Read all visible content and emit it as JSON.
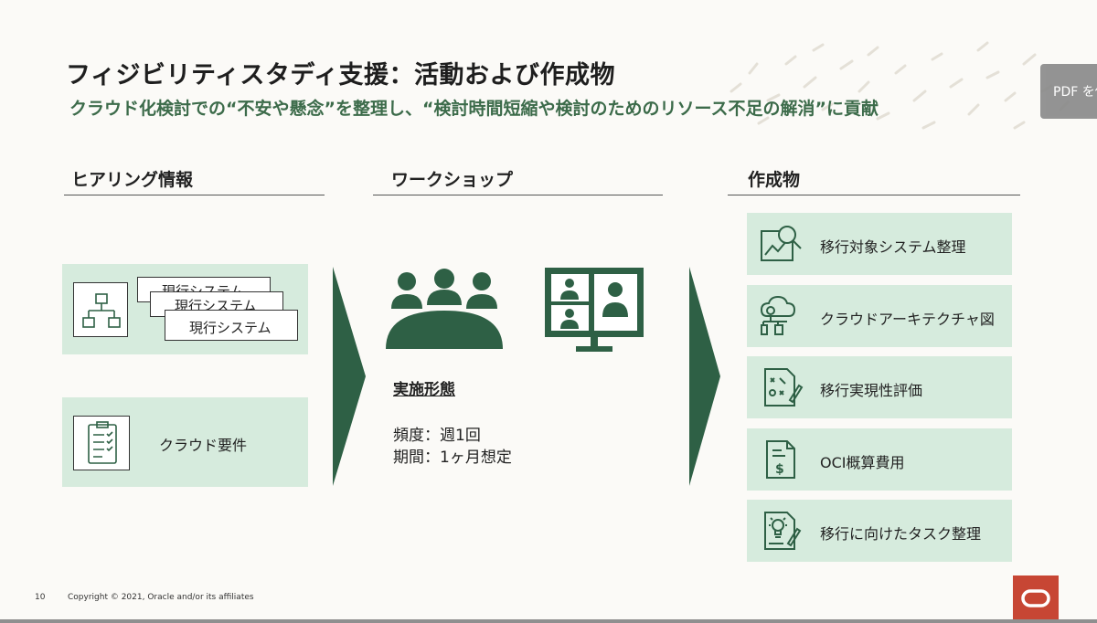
{
  "title": "フィジビリティスタディ支援：活動および作成物",
  "subtitle": "クラウド化検討での“不安や懸念”を整理し、“検討時間短縮や検討のためのリソース不足の解消”に貢献",
  "pdf_button": "PDF を使",
  "columns": {
    "hearing": {
      "heading": "ヒアリング情報",
      "system_doc_back1": "現行システム",
      "system_doc_back2": "現行システム",
      "system_doc_front": "現行システム",
      "requirements": "クラウド要件"
    },
    "workshop": {
      "heading": "ワークショップ",
      "impl_heading": "実施形態",
      "frequency": "頻度：週1回",
      "period": "期間：1ヶ月想定"
    },
    "outputs": {
      "heading": "作成物",
      "items": [
        {
          "label": "移行対象システム整理",
          "icon": "magnify-chart-icon"
        },
        {
          "label": "クラウドアーキテクチャ図",
          "icon": "cloud-architecture-icon"
        },
        {
          "label": "移行実現性評価",
          "icon": "strategy-document-icon"
        },
        {
          "label": "OCI概算費用",
          "icon": "dollar-document-icon"
        },
        {
          "label": "移行に向けたタスク整理",
          "icon": "idea-document-icon"
        }
      ]
    }
  },
  "footer": {
    "page_number": "10",
    "copyright": "Copyright © 2021, Oracle and/or its affiliates"
  },
  "colors": {
    "accent_green": "#2e6045",
    "card_green": "#d6ebdd",
    "subtitle_green": "#3c6b4a",
    "oracle_red": "#c74634"
  }
}
